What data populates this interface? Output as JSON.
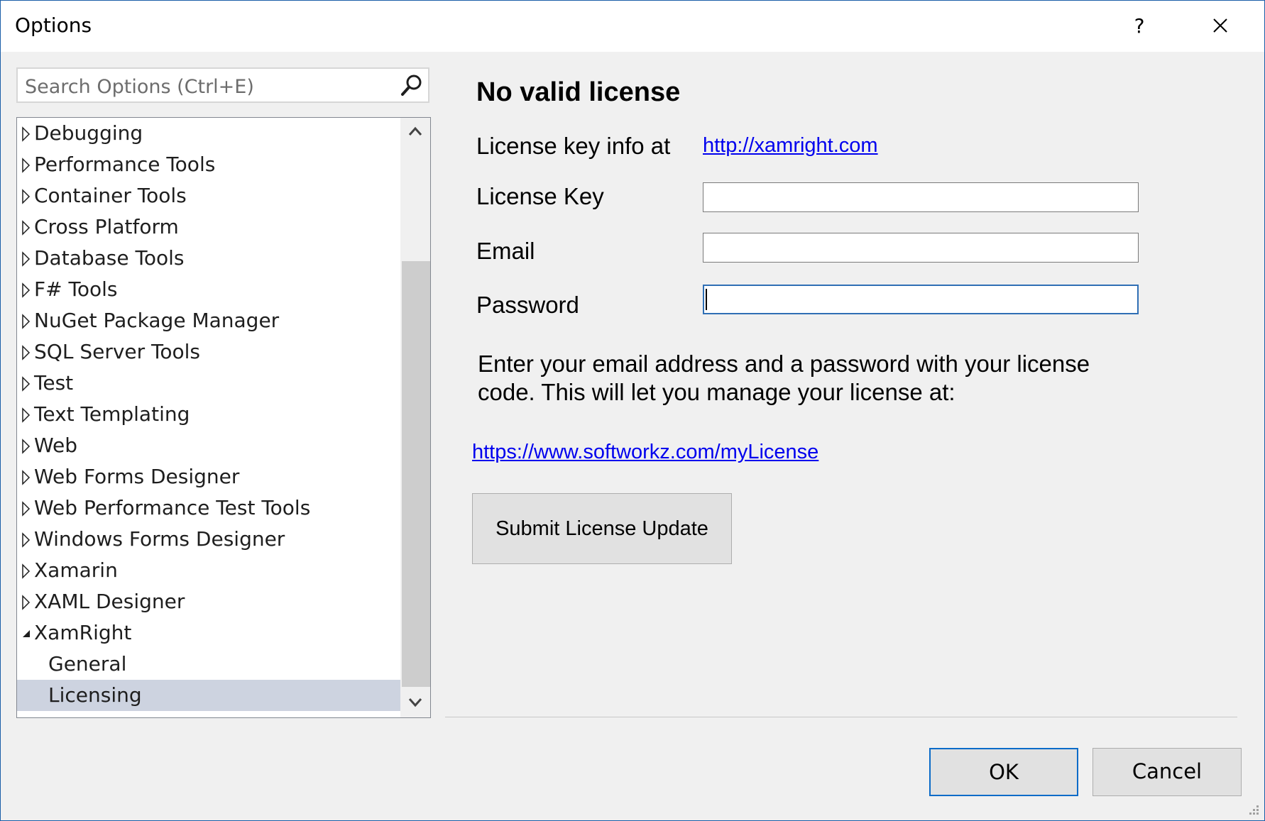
{
  "window": {
    "title": "Options",
    "help_label": "?"
  },
  "search": {
    "placeholder": "Search Options (Ctrl+E)"
  },
  "tree": {
    "items": [
      {
        "label": "Debugging"
      },
      {
        "label": "Performance Tools"
      },
      {
        "label": "Container Tools"
      },
      {
        "label": "Cross Platform"
      },
      {
        "label": "Database Tools"
      },
      {
        "label": "F# Tools"
      },
      {
        "label": "NuGet Package Manager"
      },
      {
        "label": "SQL Server Tools"
      },
      {
        "label": "Test"
      },
      {
        "label": "Text Templating"
      },
      {
        "label": "Web"
      },
      {
        "label": "Web Forms Designer"
      },
      {
        "label": "Web Performance Test Tools"
      },
      {
        "label": "Windows Forms Designer"
      },
      {
        "label": "Xamarin"
      },
      {
        "label": "XAML Designer"
      },
      {
        "label": "XamRight",
        "expanded": true
      },
      {
        "label": "General",
        "child": true
      },
      {
        "label": "Licensing",
        "child": true,
        "selected": true
      }
    ]
  },
  "license": {
    "heading": "No valid license",
    "info_label": "License key info at",
    "info_link": "http://xamright.com",
    "key_label": "License Key",
    "key_value": "",
    "email_label": "Email",
    "email_value": "",
    "password_label": "Password",
    "password_value": "",
    "description": "Enter your email address and a password with your license code. This will let you manage your license at:",
    "manage_link": "https://www.softworkz.com/myLicense",
    "submit_label": "Submit License Update"
  },
  "footer": {
    "ok_label": "OK",
    "cancel_label": "Cancel"
  },
  "colors": {
    "selection": "#cdd3e0",
    "link": "#0000ee",
    "focus_border": "#2f6fb5",
    "default_button_border": "#0b6bc8"
  }
}
